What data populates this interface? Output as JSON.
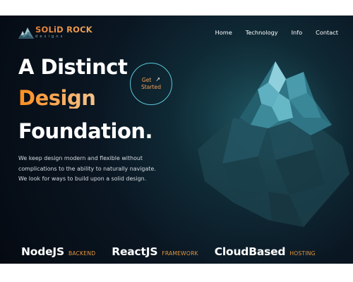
{
  "brand": {
    "name": "SOLiD ROCK",
    "tagline": "designs",
    "logo_icon": "mountain-logo-icon"
  },
  "nav": {
    "items": [
      {
        "label": "Home"
      },
      {
        "label": "Technology"
      },
      {
        "label": "Info"
      },
      {
        "label": "Contact"
      }
    ]
  },
  "hero": {
    "line1": "A Distinct",
    "line2": "Design",
    "line3": "Foundation.",
    "cta_line1": "Get",
    "cta_line2": "Started",
    "cta_icon": "arrow-up-right-icon",
    "description": [
      "We keep design modern and flexible without",
      "complications to the ability to naturally navigate.",
      "We look for ways to build upon a solid design."
    ]
  },
  "stats": [
    {
      "title": "NodeJS",
      "tag": "BACKEND"
    },
    {
      "title": "ReactJS",
      "tag": "FRAMEWORK"
    },
    {
      "title": "CloudBased",
      "tag": "HOSTING"
    }
  ],
  "colors": {
    "accent_orange": "#f0943a",
    "accent_teal": "#5cc6d8",
    "background": "#0a1622"
  }
}
